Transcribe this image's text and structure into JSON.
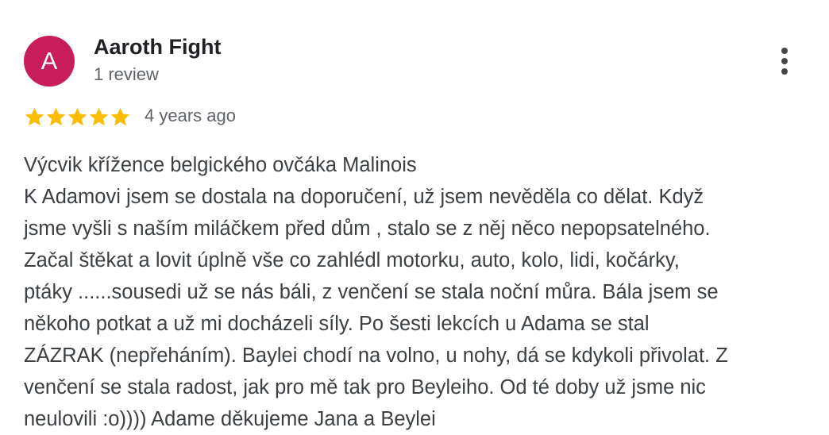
{
  "review": {
    "avatar_letter": "A",
    "avatar_color": "#c81d5b",
    "author_name": "Aaroth Fight",
    "review_count": "1 review",
    "more_icon": "more-vert-icon",
    "rating": 5,
    "rating_max": 5,
    "star_color": "#fbbc04",
    "date": "4 years ago",
    "text_lines": [
      "Výcvik křížence belgického ovčáka Malinois",
      "K Adamovi jsem se dostala na doporučení, už jsem nevěděla co dělat. Když",
      "jsme vyšli s naším miláčkem před dům , stalo se z něj něco nepopsatelného.",
      "Začal štěkat a lovit úplně vše co zahlédl motorku, auto, kolo, lidi, kočárky,",
      "ptáky ......sousedi už se nás báli, z venčení se stala noční můra. Bála jsem se",
      "někoho potkat a už mi docházeli síly. Po šesti lekcích u Adama se stal",
      "ZÁZRAK (nepřeháním). Baylei chodí na volno, u nohy, dá se kdykoli přivolat. Z",
      "venčení se stala radost, jak pro mě tak pro Beyleiho. Od té doby už jsme nic",
      "neulovili :o)))) Adame děkujeme Jana a Beylei"
    ]
  }
}
